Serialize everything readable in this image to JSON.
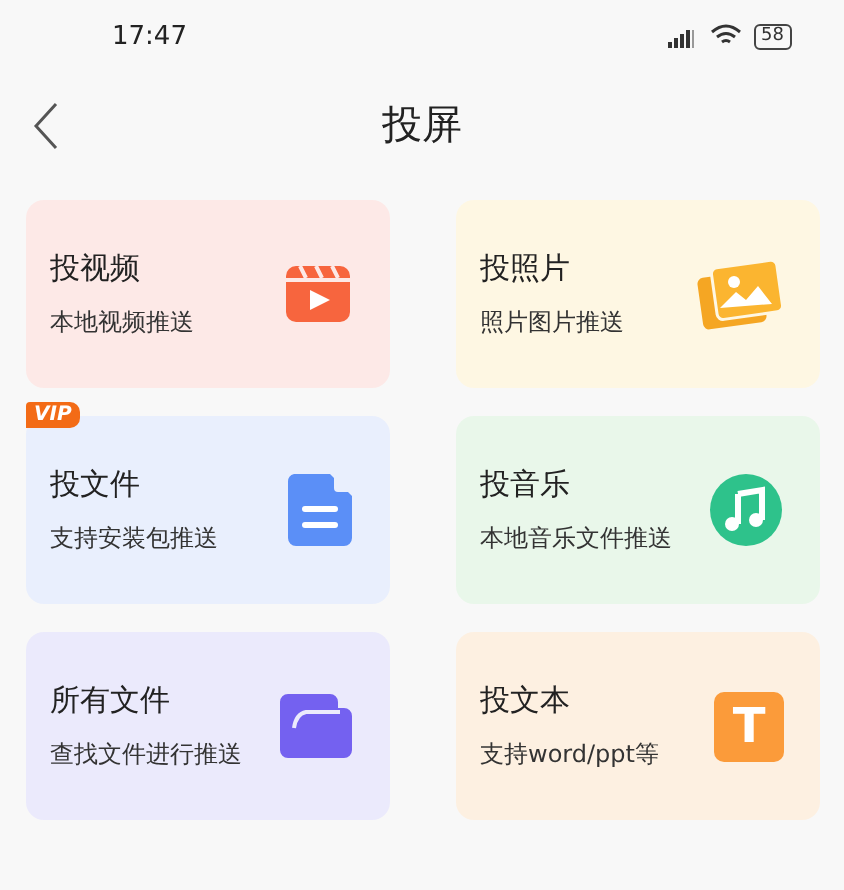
{
  "status_bar": {
    "time": "17:47",
    "battery": "58"
  },
  "header": {
    "title": "投屏"
  },
  "cards": [
    {
      "title": "投视频",
      "subtitle": "本地视频推送",
      "kind": "video",
      "color": "#fde9e7"
    },
    {
      "title": "投照片",
      "subtitle": "照片图片推送",
      "kind": "photo",
      "color": "#fef7e3"
    },
    {
      "title": "投文件",
      "subtitle": "支持安装包推送",
      "kind": "file",
      "color": "#e9effd",
      "badge": "VIP"
    },
    {
      "title": "投音乐",
      "subtitle": "本地音乐文件推送",
      "kind": "music",
      "color": "#e9f7ea"
    },
    {
      "title": "所有文件",
      "subtitle": "查找文件进行推送",
      "kind": "folder",
      "color": "#ebeafc"
    },
    {
      "title": "投文本",
      "subtitle": "支持word/ppt等",
      "kind": "text",
      "icon_text": "T",
      "color": "#fdf0e1"
    }
  ]
}
